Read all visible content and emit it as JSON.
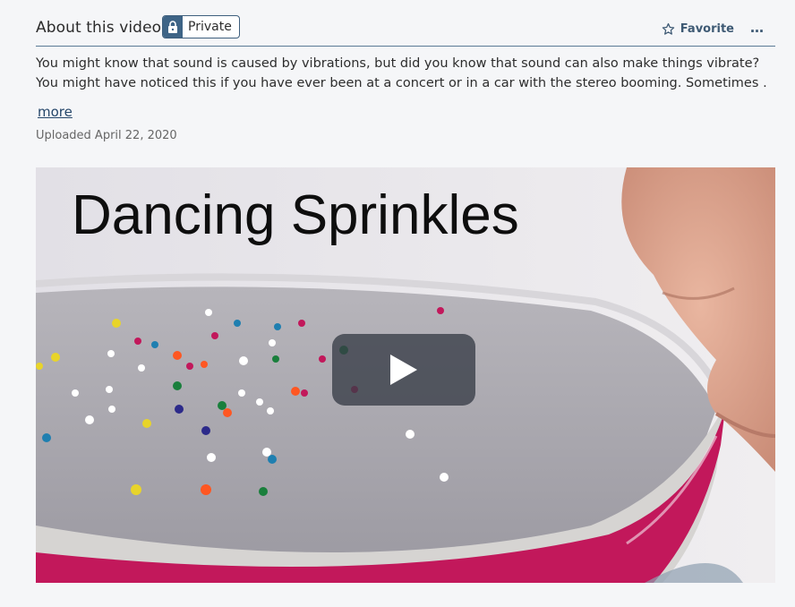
{
  "header": {
    "title": "About this video",
    "badge": "Private",
    "favorite": "Favorite",
    "more_menu": "…"
  },
  "description": {
    "line1": "You might know that sound is caused by vibrations, but did you know that sound can also make things vibrate?",
    "line2": "You might have noticed this if you have ever been at a concert or in a car with the stereo booming. Sometimes …",
    "more_label": "more",
    "uploaded": "Uploaded April 22, 2020"
  },
  "player": {
    "video_title": "Dancing Sprinkles",
    "play_icon": "play-icon"
  },
  "colors": {
    "accent": "#3e6486",
    "link": "#25466a",
    "bowl_rim": "#c2185b"
  }
}
